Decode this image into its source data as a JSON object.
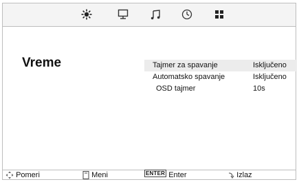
{
  "top_icons": [
    "sun-icon",
    "monitor-icon",
    "music-note-icon",
    "clock-icon",
    "grid-icon"
  ],
  "page": {
    "title": "Vreme"
  },
  "menu": {
    "items": [
      {
        "label": "Tajmer za spavanje",
        "value": "Isključeno",
        "selected": true
      },
      {
        "label": "Automatsko spavanje",
        "value": "Isključeno",
        "selected": false
      },
      {
        "label": "OSD tajmer",
        "value": "10s",
        "selected": false
      }
    ]
  },
  "footer": {
    "move_label": "Pomeri",
    "menu_label": "Meni",
    "enter_key": "ENTER",
    "enter_label": "Enter",
    "exit_label": "Izlaz"
  },
  "colors": {
    "selected_row": "#ececec",
    "border": "#bdbdbd",
    "topbar": "#f4f4f4"
  }
}
